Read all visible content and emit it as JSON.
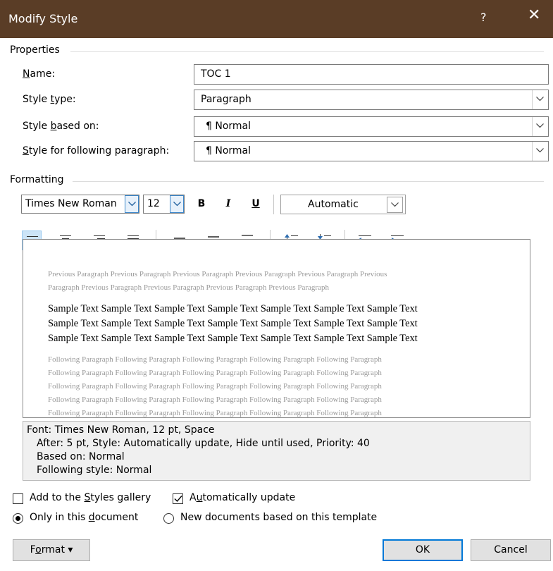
{
  "window": {
    "title": "Modify Style",
    "help_glyph": "?",
    "close_glyph": "✕"
  },
  "properties": {
    "section_label": "Properties",
    "name": {
      "label_pre": "",
      "label_key": "N",
      "label_post": "ame:",
      "value": "TOC 1"
    },
    "style_type": {
      "label_pre": "Style ",
      "label_key": "t",
      "label_post": "ype:",
      "value": "Paragraph"
    },
    "based_on": {
      "label_pre": "Style ",
      "label_key": "b",
      "label_post": "ased on:",
      "pilcrow": "¶",
      "value": "Normal"
    },
    "following": {
      "label_pre": "",
      "label_key": "S",
      "label_post": "tyle for following paragraph:",
      "pilcrow": "¶",
      "value": "Normal"
    }
  },
  "formatting": {
    "section_label": "Formatting",
    "font_name": "Times New Roman",
    "font_size": "12",
    "bold": "B",
    "italic": "I",
    "underline": "U",
    "color": "Automatic"
  },
  "preview": {
    "previous": [
      "Previous Paragraph Previous Paragraph Previous Paragraph Previous Paragraph Previous Paragraph Previous",
      "Paragraph Previous Paragraph Previous Paragraph Previous Paragraph Previous Paragraph"
    ],
    "sample": [
      "Sample Text Sample Text Sample Text Sample Text Sample Text Sample Text Sample Text",
      "Sample Text Sample Text Sample Text Sample Text Sample Text Sample Text Sample Text",
      "Sample Text Sample Text Sample Text Sample Text Sample Text Sample Text Sample Text"
    ],
    "following": [
      "Following Paragraph Following Paragraph Following Paragraph Following Paragraph Following Paragraph",
      "Following Paragraph Following Paragraph Following Paragraph Following Paragraph Following Paragraph",
      "Following Paragraph Following Paragraph Following Paragraph Following Paragraph Following Paragraph",
      "Following Paragraph Following Paragraph Following Paragraph Following Paragraph Following Paragraph",
      "Following Paragraph Following Paragraph Following Paragraph Following Paragraph Following Paragraph"
    ]
  },
  "description": [
    "Font: Times New Roman, 12 pt, Space",
    "After:  5 pt, Style: Automatically update, Hide until used, Priority: 40",
    "Based on: Normal",
    "Following style: Normal"
  ],
  "options": {
    "add_gallery": {
      "pre": "Add to the ",
      "key": "S",
      "post": "tyles gallery",
      "checked": false
    },
    "auto_update": {
      "pre": "A",
      "key": "u",
      "post": "tomatically update",
      "checked": true
    },
    "only_doc": {
      "pre": "Only in this ",
      "key": "d",
      "post": "ocument",
      "selected": true
    },
    "new_docs": {
      "pre": "New documents based on this template",
      "selected": false
    }
  },
  "buttons": {
    "format_pre": "F",
    "format_key": "o",
    "format_post": "rmat",
    "format_arrow": "▾",
    "ok": "OK",
    "cancel": "Cancel"
  },
  "colors": {
    "titlebar": "#5a3d26",
    "accent": "#3c86c9"
  }
}
